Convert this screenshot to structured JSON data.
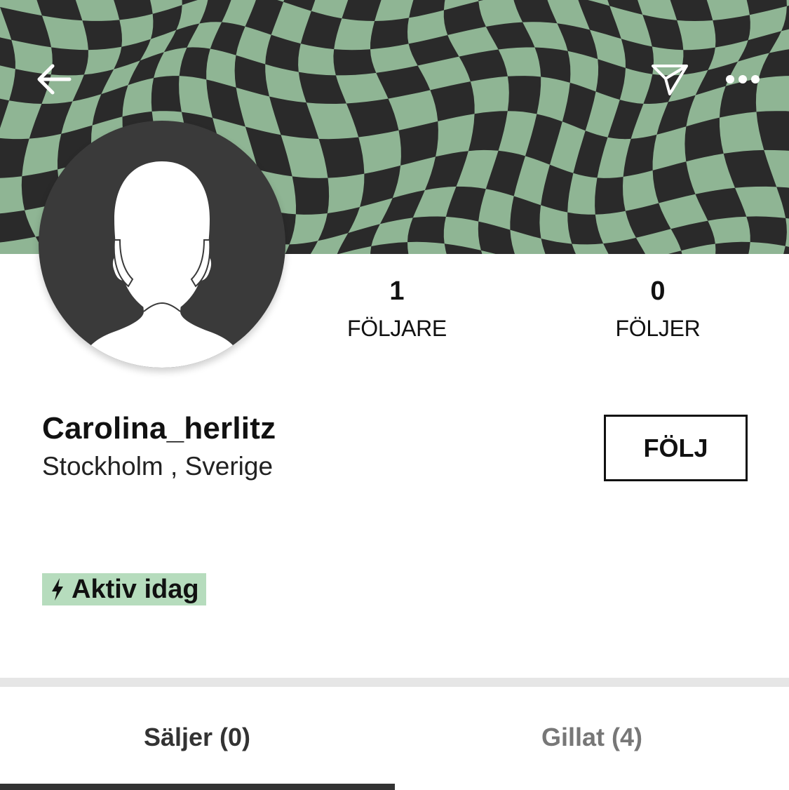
{
  "header": {
    "back_icon": "arrow-left-icon",
    "share_icon": "paper-plane-icon",
    "more_icon": "more-dots-icon"
  },
  "cover": {
    "pattern_colors": {
      "light": "#8fb594",
      "dark": "#2a2a2a"
    }
  },
  "profile": {
    "avatar_icon": "default-user-silhouette",
    "username": "Carolina_herlitz",
    "location": "Stockholm , Sverige",
    "follow_label": "FÖLJ",
    "active_status": "Aktiv idag",
    "active_color": "#b6dcbd"
  },
  "stats": {
    "followers_count": "1",
    "followers_label": "FÖLJARE",
    "following_count": "0",
    "following_label": "FÖLJER"
  },
  "tabs": [
    {
      "label": "Säljer (0)",
      "selected": true
    },
    {
      "label": "Gillat (4)",
      "selected": false
    }
  ]
}
